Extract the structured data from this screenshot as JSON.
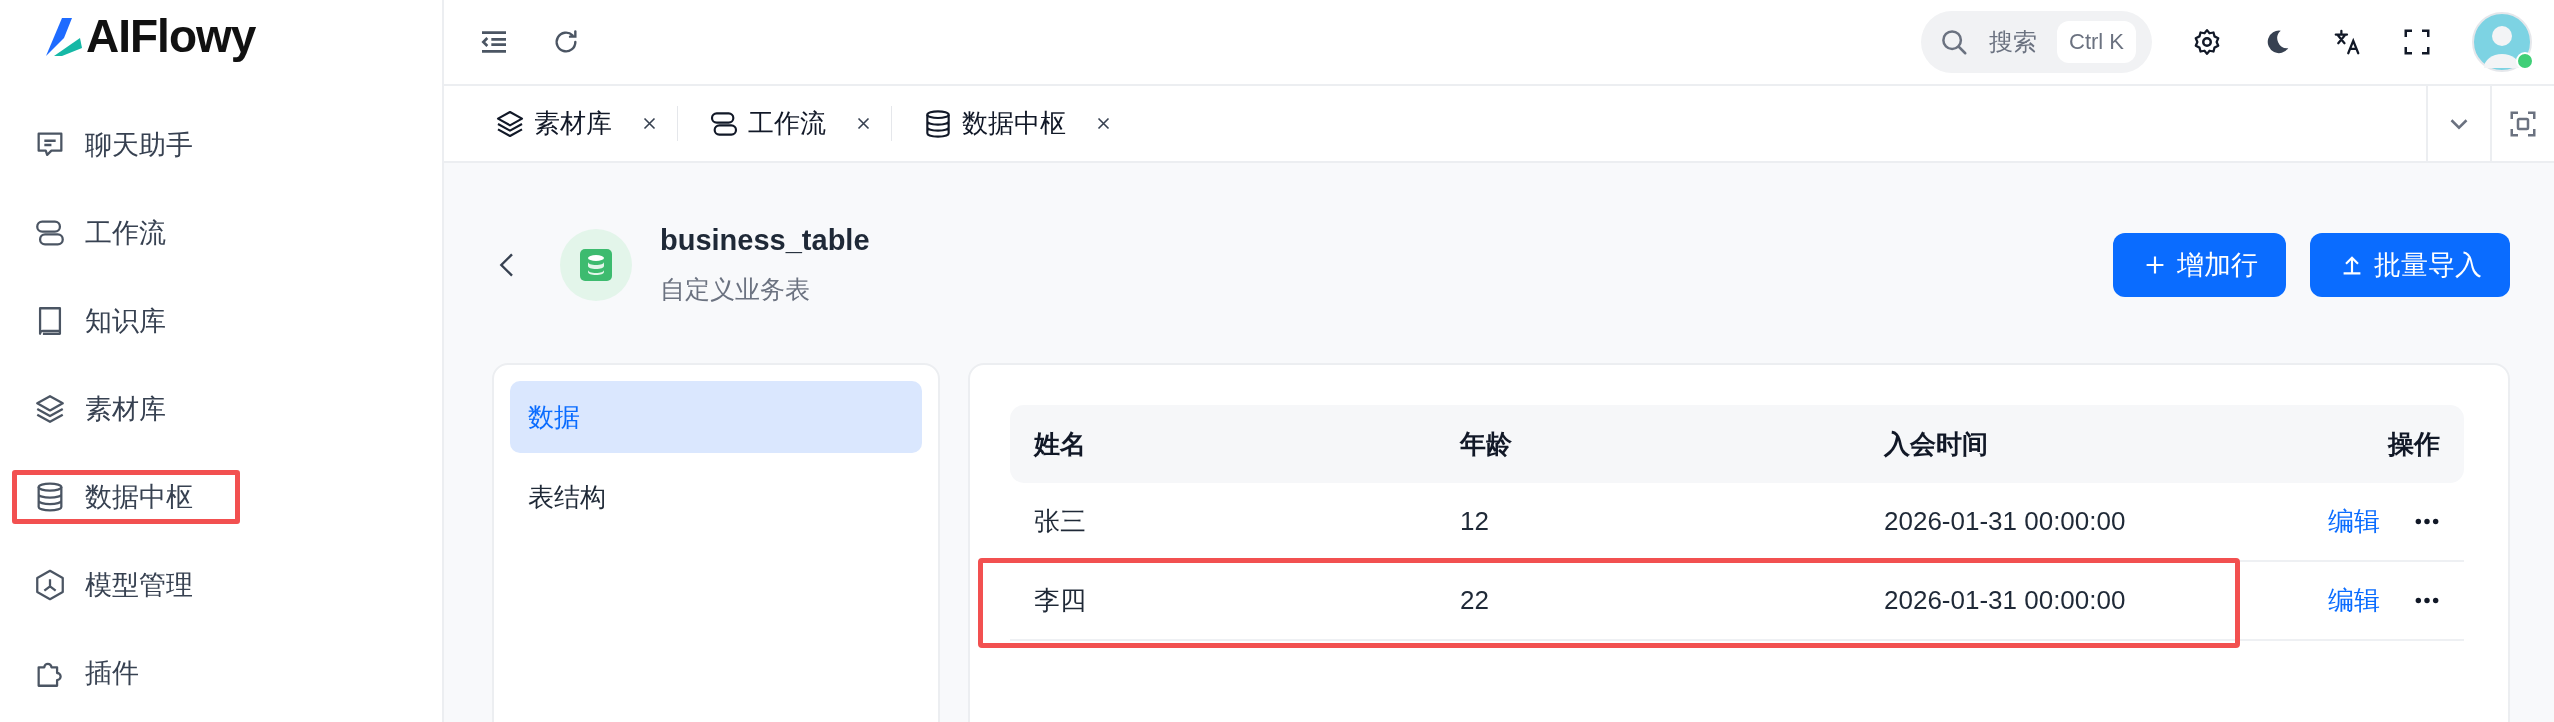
{
  "logo": {
    "text": "AIFlowy"
  },
  "sidebar": {
    "items": [
      {
        "label": "聊天助手",
        "kind": "chat",
        "highlighted": false
      },
      {
        "label": "工作流",
        "kind": "flow",
        "highlighted": false
      },
      {
        "label": "知识库",
        "kind": "book",
        "highlighted": false
      },
      {
        "label": "素材库",
        "kind": "layers",
        "highlighted": false
      },
      {
        "label": "数据中枢",
        "kind": "database",
        "highlighted": true
      },
      {
        "label": "模型管理",
        "kind": "model",
        "highlighted": false
      },
      {
        "label": "插件",
        "kind": "puzzle",
        "highlighted": false
      }
    ]
  },
  "topbar": {
    "search": {
      "placeholder": "搜索",
      "shortcut": "Ctrl K"
    },
    "avatar": {
      "online": true
    }
  },
  "tabs": [
    {
      "label": "素材库",
      "kind": "layers"
    },
    {
      "label": "工作流",
      "kind": "flow"
    },
    {
      "label": "数据中枢",
      "kind": "database"
    }
  ],
  "header": {
    "title": "business_table",
    "subtitle": "自定义业务表"
  },
  "buttons": [
    {
      "label": "增加行",
      "kind": "add"
    },
    {
      "label": "批量导入",
      "kind": "upload"
    }
  ],
  "subnav": [
    {
      "label": "数据",
      "selected": true
    },
    {
      "label": "表结构",
      "selected": false
    }
  ],
  "table": {
    "columns": [
      "姓名",
      "年龄",
      "入会时间",
      "操作"
    ],
    "rows": [
      {
        "cells": [
          "张三",
          "12",
          "2026-01-31 00:00:00"
        ],
        "action": "编辑",
        "highlighted": false
      },
      {
        "cells": [
          "李四",
          "22",
          "2026-01-31 00:00:00"
        ],
        "action": "编辑",
        "highlighted": true
      }
    ]
  }
}
